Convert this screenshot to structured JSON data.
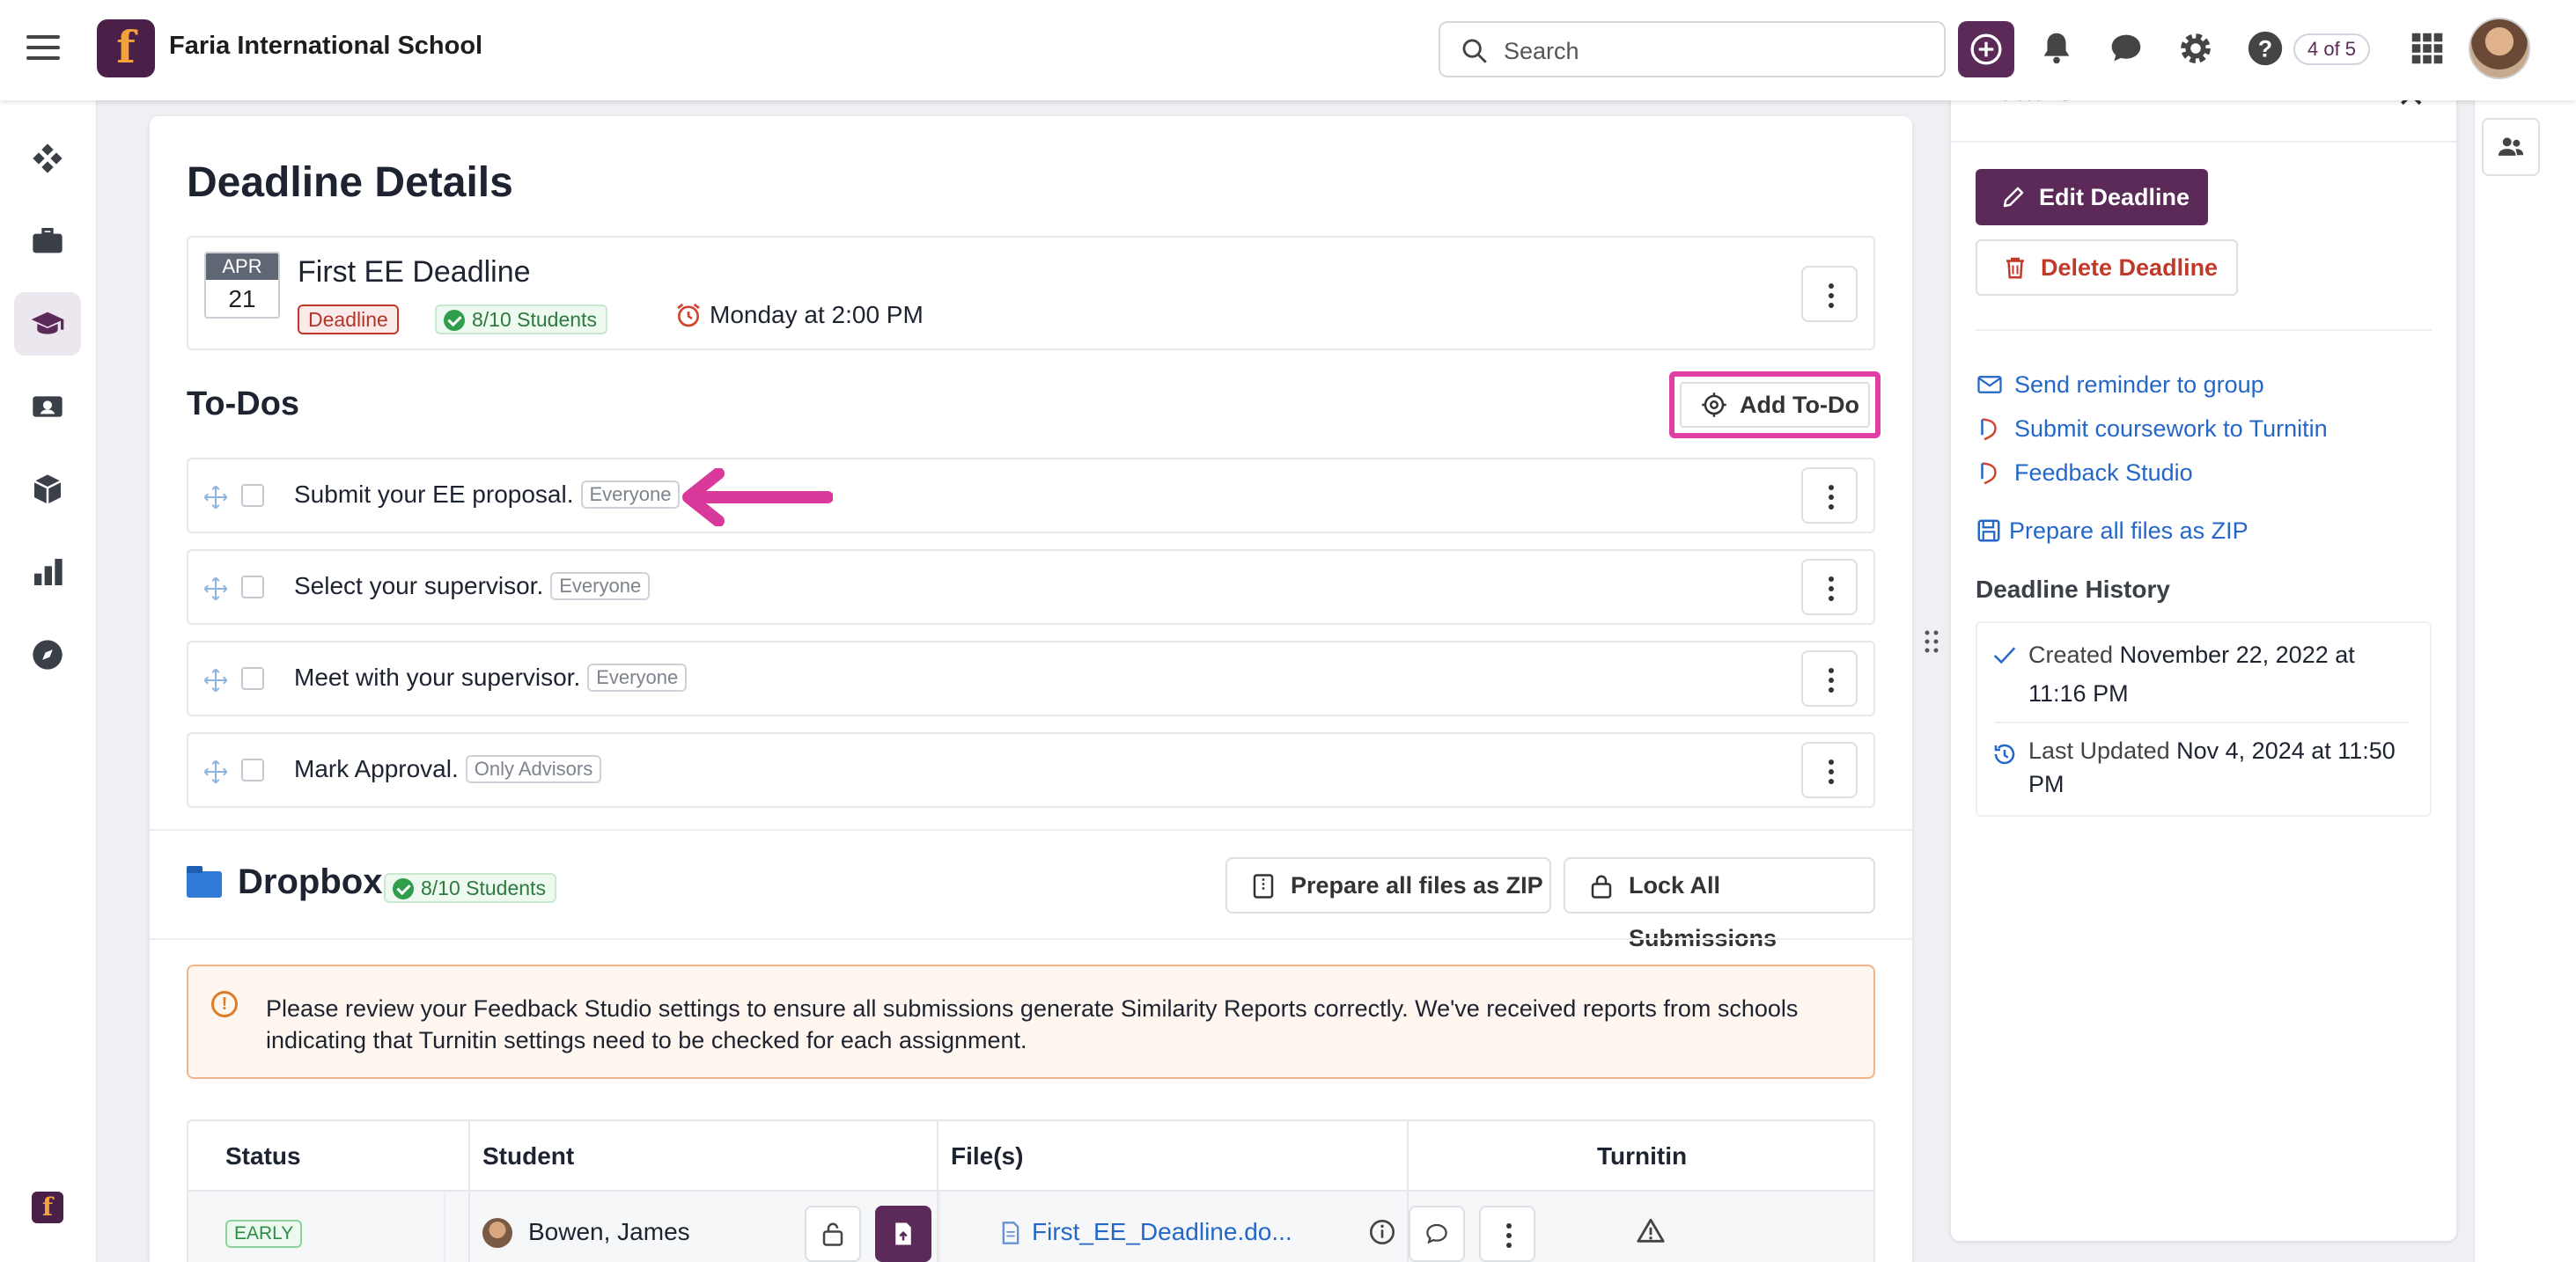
{
  "topbar": {
    "school_name": "Faria International School",
    "logo_letter": "f",
    "search_placeholder": "Search",
    "page_counter": "4 of 5"
  },
  "colors": {
    "brand": "#5b2a59",
    "highlight": "#e23fa5",
    "link": "#2467c8",
    "danger": "#c0392b",
    "success": "#2f9e4a"
  },
  "leftnav": {
    "items": [
      "dashboard-icon",
      "briefcase-icon",
      "graduation-cap-icon",
      "id-card-icon",
      "box-icon",
      "bar-chart-icon",
      "compass-icon"
    ],
    "active": "graduation-cap-icon"
  },
  "main": {
    "title": "Deadline Details",
    "deadline": {
      "month": "APR",
      "day": "21",
      "name": "First EE Deadline",
      "type_tag": "Deadline",
      "students": "8/10 Students",
      "when": "Monday at 2:00 PM"
    },
    "todos": {
      "heading": "To-Dos",
      "add_label": "Add To-Do",
      "items": [
        {
          "text": "Submit your EE proposal.",
          "audience": "Everyone"
        },
        {
          "text": "Select your supervisor.",
          "audience": "Everyone"
        },
        {
          "text": "Meet with your supervisor.",
          "audience": "Everyone"
        },
        {
          "text": "Mark Approval.",
          "audience": "Only Advisors"
        }
      ]
    },
    "dropbox": {
      "heading": "Dropbox",
      "students": "8/10 Students",
      "zip_label": "Prepare all files as ZIP",
      "lock_label": "Lock All Submissions",
      "alert": "Please review your Feedback Studio settings to ensure all submissions generate Similarity Reports correctly. We've received reports from schools indicating that Turnitin settings need to be checked for each assignment.",
      "columns": [
        "Status",
        "Student",
        "File(s)",
        "Turnitin"
      ],
      "rows": [
        {
          "status": "EARLY",
          "student": "Bowen, James",
          "file": "First_EE_Deadline.do..."
        }
      ]
    }
  },
  "details": {
    "title": "Details",
    "edit_label": "Edit Deadline",
    "delete_label": "Delete Deadline",
    "links": [
      "Send reminder to group",
      "Submit coursework to Turnitin",
      "Feedback Studio",
      "Prepare all files as ZIP"
    ],
    "history_heading": "Deadline History",
    "created_label": "Created",
    "created_value": "November 22, 2022 at 11:16 PM",
    "updated_label": "Last Updated",
    "updated_value": "Nov 4, 2024 at 11:50 PM"
  }
}
